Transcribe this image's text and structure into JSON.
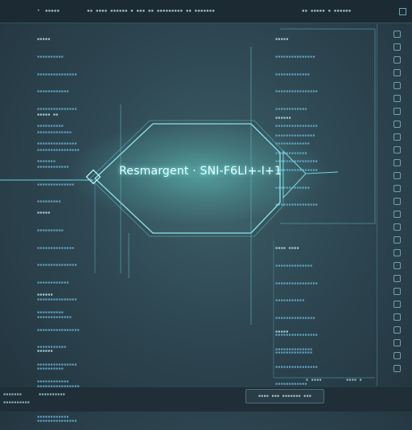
{
  "topbar": {
    "tab_left": "•",
    "tab_menu": "▪▪▪▪▪",
    "center_text": "▪▪ ▪▪▪▪ ▪▪▪▪▪▪ ▪ ▪▪▪ ▪▪ ▪▪▪▪▪▪▪▪▪ ▪▪ ▪▪▪▪▪▪▪",
    "right_text": "▪▪ ▪▪▪▪▪ ▪ ▪▪▪▪▪▪"
  },
  "main": {
    "node_label": "Resmargent · SNI-F6LI+-I+1"
  },
  "left_columns": [
    {
      "header": "▪▪▪▪▪",
      "rows": [
        "▪▪▪▪▪▪▪▪▪▪",
        "▪▪▪▪▪▪▪▪▪▪▪▪▪▪▪",
        "▪▪▪▪▪▪▪▪▪▪▪▪",
        "▪▪▪▪▪▪▪▪▪▪▪▪▪▪▪",
        "▪▪▪▪▪▪▪▪▪▪",
        "▪▪▪▪▪▪▪▪▪▪▪▪▪▪▪",
        "▪▪▪▪▪▪▪"
      ]
    },
    {
      "header": "▪▪▪▪▪ ▪▪",
      "rows": [
        "▪▪▪▪▪▪▪▪▪▪▪▪▪",
        "▪▪▪▪▪▪▪▪▪▪▪▪▪▪▪▪",
        "▪▪▪▪▪▪▪▪▪▪▪▪",
        "▪▪▪▪▪▪▪▪▪▪▪▪▪▪",
        "▪▪▪▪▪▪▪▪▪"
      ]
    },
    {
      "header": "▪▪▪▪▪",
      "rows": [
        "▪▪▪▪▪▪▪▪▪▪",
        "▪▪▪▪▪▪▪▪▪▪▪▪▪▪",
        "▪▪▪▪▪▪▪▪▪▪▪▪▪▪▪",
        "▪▪▪▪▪▪▪▪▪▪▪▪",
        "▪▪▪▪▪▪▪▪▪▪▪▪▪▪▪",
        "▪▪▪▪▪▪▪▪▪▪▪▪▪"
      ]
    },
    {
      "header": "▪▪▪▪▪▪",
      "rows": [
        "▪▪▪▪▪▪▪▪▪▪",
        "▪▪▪▪▪▪▪▪▪▪▪▪▪▪▪▪",
        "▪▪▪▪▪▪▪▪▪▪▪",
        "▪▪▪▪▪▪▪▪▪▪▪▪▪▪▪",
        "▪▪▪▪▪▪▪▪▪▪▪▪",
        "▪▪▪▪▪▪▪▪▪▪▪▪▪▪▪▪",
        "▪▪▪▪▪▪▪▪▪▪▪▪"
      ]
    },
    {
      "header": "▪▪▪▪▪▪",
      "rows": [
        "▪▪▪▪▪▪▪▪▪▪",
        "▪▪▪▪▪▪▪▪▪▪▪▪▪▪▪▪",
        "▪▪▪▪▪▪▪▪▪▪▪▪",
        "▪▪▪▪▪▪▪▪▪▪▪▪▪▪▪"
      ]
    }
  ],
  "right_columns": [
    {
      "header": "▪▪▪▪▪",
      "rows": [
        "▪▪▪▪▪▪▪▪▪▪▪▪▪▪▪",
        "▪▪▪▪▪▪▪▪▪▪▪▪▪",
        "▪▪▪▪▪▪▪▪▪▪▪▪▪▪▪▪",
        "▪▪▪▪▪▪▪▪▪▪▪▪",
        "▪▪▪▪▪▪▪▪▪▪▪▪▪▪▪▪",
        "▪▪▪▪▪▪▪▪▪▪▪▪▪",
        "▪▪▪▪▪▪▪▪▪▪▪▪▪▪▪▪"
      ]
    },
    {
      "header": "▪▪▪▪▪▪",
      "rows": [
        "▪▪▪▪▪▪▪▪▪▪▪▪▪▪▪",
        "▪▪▪▪▪▪▪▪▪▪▪▪",
        "▪▪▪▪▪▪▪▪▪▪▪▪▪▪▪▪",
        "▪▪▪▪▪▪▪▪▪▪▪▪▪",
        "▪▪▪▪▪▪▪▪▪▪▪▪▪▪▪▪"
      ]
    },
    {
      "header": "▪▪▪▪ ▪▪▪▪",
      "rows": [
        "▪▪▪▪▪▪▪▪▪▪▪▪▪▪",
        "▪▪▪▪▪▪▪▪▪▪▪▪▪▪▪▪",
        "▪▪▪▪▪▪▪▪▪▪▪",
        "▪▪▪▪▪▪▪▪▪▪▪▪▪▪▪",
        "▪▪▪▪▪▪▪▪▪▪▪▪▪▪▪▪",
        "▪▪▪▪▪▪▪▪▪▪▪▪▪▪"
      ]
    },
    {
      "header": "▪▪▪▪▪",
      "rows": [
        "▪▪▪▪▪▪▪▪▪▪▪▪▪▪",
        "▪▪▪▪▪▪▪▪▪▪▪▪▪▪▪▪",
        "▪▪▪▪▪▪▪▪▪▪▪▪"
      ]
    }
  ],
  "bottombar": {
    "left_a": "▪▪▪▪▪▪▪",
    "left_b": "▪▪▪▪▪▪▪▪▪▪",
    "button_label": "▪▪▪▪ ▪▪▪ ▪▪▪▪▪▪▪ ▪▪▪",
    "right_a": "▪ ▪▪▪▪",
    "right_b": "▪▪▪▪ ▪"
  },
  "colors": {
    "accent": "#6dd3e4",
    "text": "#63a6c4",
    "bg": "#2e4752"
  }
}
